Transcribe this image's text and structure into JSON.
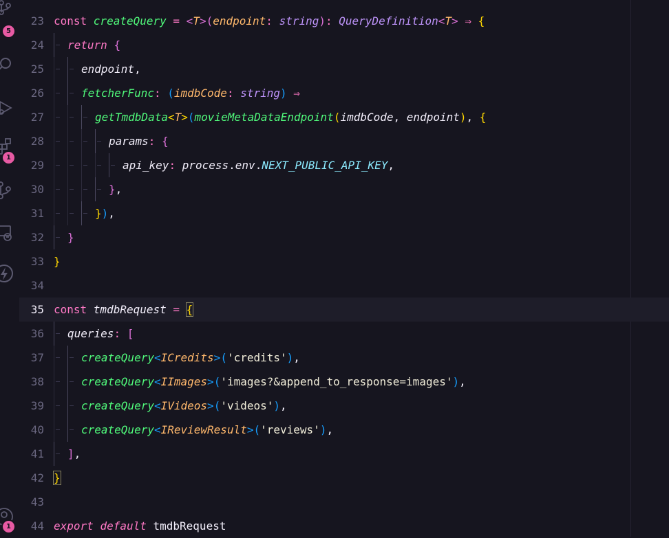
{
  "activity_bar": {
    "items": [
      {
        "icon": "source-control-icon",
        "badge": "5"
      },
      {
        "icon": "search-icon",
        "badge": ""
      },
      {
        "icon": "run-debug-icon",
        "badge": ""
      },
      {
        "icon": "extensions-icon",
        "badge": "1"
      },
      {
        "icon": "git-graph-icon",
        "badge": ""
      },
      {
        "icon": "remote-explorer-icon",
        "badge": ""
      },
      {
        "icon": "lightning-icon",
        "badge": ""
      },
      {
        "icon": "accounts-icon",
        "badge": "1"
      }
    ]
  },
  "theme": {
    "background": "#16151f",
    "keyword": "#ff79c6",
    "function": "#50fa7b",
    "type": "#ffb86c",
    "string": "#f1fa8c",
    "constant": "#8be9fd",
    "badge": "#e75aa3"
  },
  "editor": {
    "current_line": "35",
    "lines": [
      {
        "n": "23",
        "tokens": [
          {
            "c": "kw",
            "t": "const "
          },
          {
            "c": "fn",
            "t": "createQuery"
          },
          {
            "c": "op",
            "t": " = "
          },
          {
            "c": "br2",
            "t": "<"
          },
          {
            "c": "ty",
            "t": "T"
          },
          {
            "c": "br2",
            "t": ">"
          },
          {
            "c": "br2",
            "t": "("
          },
          {
            "c": "ty",
            "t": "endpoint"
          },
          {
            "c": "op",
            "t": ": "
          },
          {
            "c": "tyc",
            "t": "string"
          },
          {
            "c": "br2",
            "t": ")"
          },
          {
            "c": "op",
            "t": ": "
          },
          {
            "c": "tyc",
            "t": "QueryDefinition"
          },
          {
            "c": "br2",
            "t": "<"
          },
          {
            "c": "ty",
            "t": "T"
          },
          {
            "c": "br2",
            "t": ">"
          },
          {
            "c": "op",
            "t": " ⇒ "
          },
          {
            "c": "br1",
            "t": "{"
          }
        ]
      },
      {
        "n": "24",
        "tokens": [
          {
            "c": "kw it",
            "t": "return "
          },
          {
            "c": "br2",
            "t": "{"
          }
        ]
      },
      {
        "n": "25",
        "tokens": [
          {
            "c": "prop",
            "t": "endpoint"
          },
          {
            "c": "plain",
            "t": ","
          }
        ]
      },
      {
        "n": "26",
        "tokens": [
          {
            "c": "fn",
            "t": "fetcherFunc"
          },
          {
            "c": "op",
            "t": ": "
          },
          {
            "c": "br3",
            "t": "("
          },
          {
            "c": "ty",
            "t": "imdbCode"
          },
          {
            "c": "op",
            "t": ": "
          },
          {
            "c": "tyc",
            "t": "string"
          },
          {
            "c": "br3",
            "t": ")"
          },
          {
            "c": "op",
            "t": " ⇒"
          }
        ]
      },
      {
        "n": "27",
        "tokens": [
          {
            "c": "fn",
            "t": "getTmdbData"
          },
          {
            "c": "br1",
            "t": "<"
          },
          {
            "c": "ty",
            "t": "T"
          },
          {
            "c": "br1",
            "t": ">"
          },
          {
            "c": "br3",
            "t": "("
          },
          {
            "c": "fn",
            "t": "movieMetaDataEndpoint"
          },
          {
            "c": "br1",
            "t": "("
          },
          {
            "c": "prop",
            "t": "imdbCode"
          },
          {
            "c": "plain",
            "t": ", "
          },
          {
            "c": "prop",
            "t": "endpoint"
          },
          {
            "c": "br1",
            "t": ")"
          },
          {
            "c": "plain",
            "t": ", "
          },
          {
            "c": "br1",
            "t": "{"
          }
        ]
      },
      {
        "n": "28",
        "tokens": [
          {
            "c": "prop",
            "t": "params"
          },
          {
            "c": "op",
            "t": ": "
          },
          {
            "c": "br2",
            "t": "{"
          }
        ]
      },
      {
        "n": "29",
        "tokens": [
          {
            "c": "prop",
            "t": "api_key"
          },
          {
            "c": "op",
            "t": ": "
          },
          {
            "c": "prop",
            "t": "process"
          },
          {
            "c": "plain",
            "t": "."
          },
          {
            "c": "prop",
            "t": "env"
          },
          {
            "c": "plain",
            "t": "."
          },
          {
            "c": "cst",
            "t": "NEXT_PUBLIC_API_KEY"
          },
          {
            "c": "plain",
            "t": ","
          }
        ]
      },
      {
        "n": "30",
        "tokens": [
          {
            "c": "br2",
            "t": "}"
          },
          {
            "c": "plain",
            "t": ","
          }
        ]
      },
      {
        "n": "31",
        "tokens": [
          {
            "c": "br1",
            "t": "}"
          },
          {
            "c": "br3",
            "t": ")"
          },
          {
            "c": "plain",
            "t": ","
          }
        ]
      },
      {
        "n": "32",
        "tokens": [
          {
            "c": "br2",
            "t": "}"
          }
        ]
      },
      {
        "n": "33",
        "tokens": [
          {
            "c": "br1",
            "t": "}"
          }
        ]
      },
      {
        "n": "34",
        "tokens": []
      },
      {
        "n": "35",
        "tokens": [
          {
            "c": "kw",
            "t": "const "
          },
          {
            "c": "prop",
            "t": "tmdbRequest"
          },
          {
            "c": "op",
            "t": " = "
          },
          {
            "c": "br1 cursor-box",
            "t": "{"
          }
        ]
      },
      {
        "n": "36",
        "tokens": [
          {
            "c": "prop",
            "t": "queries"
          },
          {
            "c": "op",
            "t": ": "
          },
          {
            "c": "br2",
            "t": "["
          }
        ]
      },
      {
        "n": "37",
        "tokens": [
          {
            "c": "fn",
            "t": "createQuery"
          },
          {
            "c": "br3",
            "t": "<"
          },
          {
            "c": "ty",
            "t": "ICredits"
          },
          {
            "c": "br3",
            "t": ">"
          },
          {
            "c": "br3",
            "t": "("
          },
          {
            "c": "strg",
            "t": "'credits'"
          },
          {
            "c": "br3",
            "t": ")"
          },
          {
            "c": "plain",
            "t": ","
          }
        ]
      },
      {
        "n": "38",
        "tokens": [
          {
            "c": "fn",
            "t": "createQuery"
          },
          {
            "c": "br3",
            "t": "<"
          },
          {
            "c": "ty",
            "t": "IImages"
          },
          {
            "c": "br3",
            "t": ">"
          },
          {
            "c": "br3",
            "t": "("
          },
          {
            "c": "strg",
            "t": "'images?&append_to_response=images'"
          },
          {
            "c": "br3",
            "t": ")"
          },
          {
            "c": "plain",
            "t": ","
          }
        ]
      },
      {
        "n": "39",
        "tokens": [
          {
            "c": "fn",
            "t": "createQuery"
          },
          {
            "c": "br3",
            "t": "<"
          },
          {
            "c": "ty",
            "t": "IVideos"
          },
          {
            "c": "br3",
            "t": ">"
          },
          {
            "c": "br3",
            "t": "("
          },
          {
            "c": "strg",
            "t": "'videos'"
          },
          {
            "c": "br3",
            "t": ")"
          },
          {
            "c": "plain",
            "t": ","
          }
        ]
      },
      {
        "n": "40",
        "tokens": [
          {
            "c": "fn",
            "t": "createQuery"
          },
          {
            "c": "br3",
            "t": "<"
          },
          {
            "c": "ty",
            "t": "IReviewResult"
          },
          {
            "c": "br3",
            "t": ">"
          },
          {
            "c": "br3",
            "t": "("
          },
          {
            "c": "strg",
            "t": "'reviews'"
          },
          {
            "c": "br3",
            "t": ")"
          },
          {
            "c": "plain",
            "t": ","
          }
        ]
      },
      {
        "n": "41",
        "tokens": [
          {
            "c": "br2",
            "t": "]"
          },
          {
            "c": "plain",
            "t": ","
          }
        ]
      },
      {
        "n": "42",
        "tokens": [
          {
            "c": "br1 cursor-box",
            "t": "}"
          }
        ]
      },
      {
        "n": "43",
        "tokens": []
      },
      {
        "n": "44",
        "tokens": [
          {
            "c": "kw it",
            "t": "export "
          },
          {
            "c": "kw it",
            "t": "default "
          },
          {
            "c": "plain",
            "t": "tmdbRequest"
          }
        ]
      }
    ]
  }
}
